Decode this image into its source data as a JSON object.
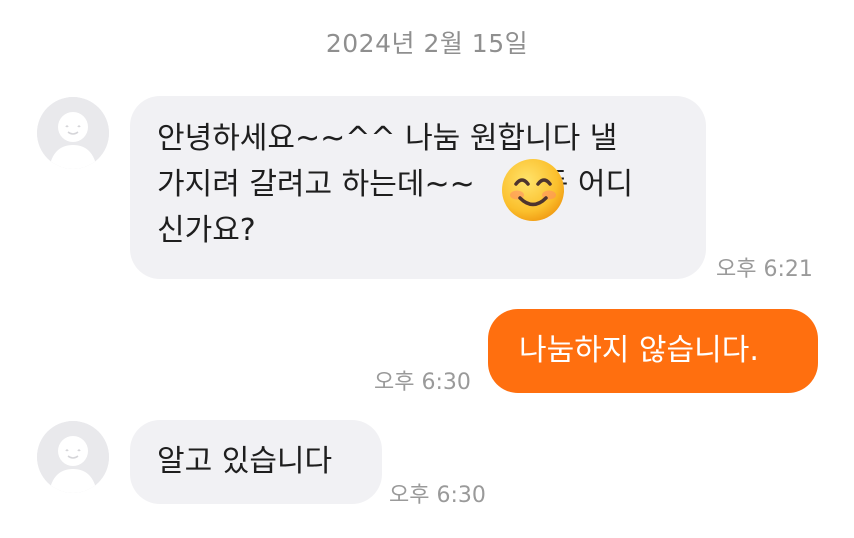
{
  "date_header": "2024년 2월 15일",
  "messages": [
    {
      "sender": "other",
      "lines": [
        "안녕하세요~~^^ 나눔 원합니다 낼",
        "가지려 갈려고 하는데~~",
        "동 어디",
        "신가요?"
      ],
      "emoji": "smiling-face",
      "time": "오후 6:21"
    },
    {
      "sender": "me",
      "text": "나눔하지 않습니다.",
      "time": "오후 6:30"
    },
    {
      "sender": "other",
      "text": "알고 있습니다",
      "time": "오후 6:30"
    }
  ],
  "colors": {
    "incoming_bubble": "#f1f1f4",
    "outgoing_bubble": "#ff6f0f",
    "timestamp": "#9a9a9a",
    "avatar_bg": "#e9e9ec"
  }
}
